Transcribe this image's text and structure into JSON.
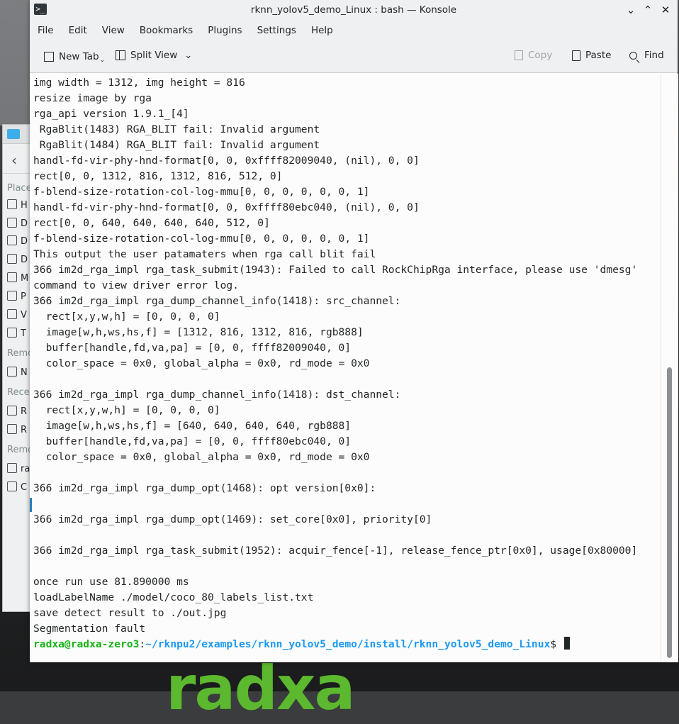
{
  "desktop": {
    "logo_text": "radxa"
  },
  "background_window": {
    "sidebar_items": [
      {
        "label": "Places",
        "type": "heading"
      },
      {
        "label": "H",
        "icon": "home-icon"
      },
      {
        "label": "D",
        "icon": "desktop-icon"
      },
      {
        "label": "D",
        "icon": "documents-icon"
      },
      {
        "label": "D",
        "icon": "downloads-icon"
      },
      {
        "label": "M",
        "icon": "music-icon"
      },
      {
        "label": "P",
        "icon": "pictures-icon"
      },
      {
        "label": "V",
        "icon": "videos-icon"
      },
      {
        "label": "T",
        "icon": "trash-icon"
      },
      {
        "label": "Remo",
        "type": "heading"
      },
      {
        "label": "N",
        "icon": "network-icon"
      },
      {
        "label": "Recen",
        "type": "heading"
      },
      {
        "label": "R",
        "icon": "recent-files-icon"
      },
      {
        "label": "R",
        "icon": "recent-locations-icon"
      },
      {
        "label": "Remo",
        "type": "heading"
      },
      {
        "label": "ra",
        "icon": "drive-icon"
      },
      {
        "label": "C",
        "icon": "sdcard-icon"
      }
    ]
  },
  "window": {
    "title": "rknn_yolov5_demo_Linux : bash — Konsole",
    "controls": [
      "minimize",
      "maximize",
      "close"
    ]
  },
  "menubar": {
    "items": [
      "File",
      "Edit",
      "View",
      "Bookmarks",
      "Plugins",
      "Settings",
      "Help"
    ]
  },
  "toolbar": {
    "new_tab": "New Tab",
    "split_view": "Split View",
    "copy": "Copy",
    "paste": "Paste",
    "find": "Find"
  },
  "terminal": {
    "lines": [
      "img width = 1312, img height = 816",
      "resize image by rga",
      "rga_api version 1.9.1_[4]",
      " RgaBlit(1483) RGA_BLIT fail: Invalid argument",
      " RgaBlit(1484) RGA_BLIT fail: Invalid argument",
      "handl-fd-vir-phy-hnd-format[0, 0, 0xffff82009040, (nil), 0, 0]",
      "rect[0, 0, 1312, 816, 1312, 816, 512, 0]",
      "f-blend-size-rotation-col-log-mmu[0, 0, 0, 0, 0, 0, 1]",
      "handl-fd-vir-phy-hnd-format[0, 0, 0xffff80ebc040, (nil), 0, 0]",
      "rect[0, 0, 640, 640, 640, 640, 512, 0]",
      "f-blend-size-rotation-col-log-mmu[0, 0, 0, 0, 0, 0, 1]",
      "This output the user patamaters when rga call blit fail",
      "366 im2d_rga_impl rga_task_submit(1943): Failed to call RockChipRga interface, please use 'dmesg'",
      "command to view driver error log.",
      "366 im2d_rga_impl rga_dump_channel_info(1418): src_channel:",
      "  rect[x,y,w,h] = [0, 0, 0, 0]",
      "  image[w,h,ws,hs,f] = [1312, 816, 1312, 816, rgb888]",
      "  buffer[handle,fd,va,pa] = [0, 0, ffff82009040, 0]",
      "  color_space = 0x0, global_alpha = 0x0, rd_mode = 0x0",
      "",
      "366 im2d_rga_impl rga_dump_channel_info(1418): dst_channel:",
      "  rect[x,y,w,h] = [0, 0, 0, 0]",
      "  image[w,h,ws,hs,f] = [640, 640, 640, 640, rgb888]",
      "  buffer[handle,fd,va,pa] = [0, 0, ffff80ebc040, 0]",
      "  color_space = 0x0, global_alpha = 0x0, rd_mode = 0x0",
      "",
      "366 im2d_rga_impl rga_dump_opt(1468): opt version[0x0]:",
      "",
      "366 im2d_rga_impl rga_dump_opt(1469): set_core[0x0], priority[0]",
      "",
      "366 im2d_rga_impl rga_task_submit(1952): acquir_fence[-1], release_fence_ptr[0x0], usage[0x80000]",
      "",
      "once run use 81.890000 ms",
      "loadLabelName ./model/coco_80_labels_list.txt",
      "save detect result to ./out.jpg",
      "Segmentation fault"
    ],
    "prompt": {
      "user_host": "radxa@radxa-zero3",
      "separator": ":",
      "path": "~/rknpu2/examples/rknn_yolov5_demo/install/rknn_yolov5_demo_Linux",
      "symbol": "$ "
    }
  },
  "colors": {
    "prompt_user": "#18b218",
    "prompt_path": "#1d99f3",
    "terminal_bg": "#fcfcfc",
    "logo": "#5cb82e"
  }
}
